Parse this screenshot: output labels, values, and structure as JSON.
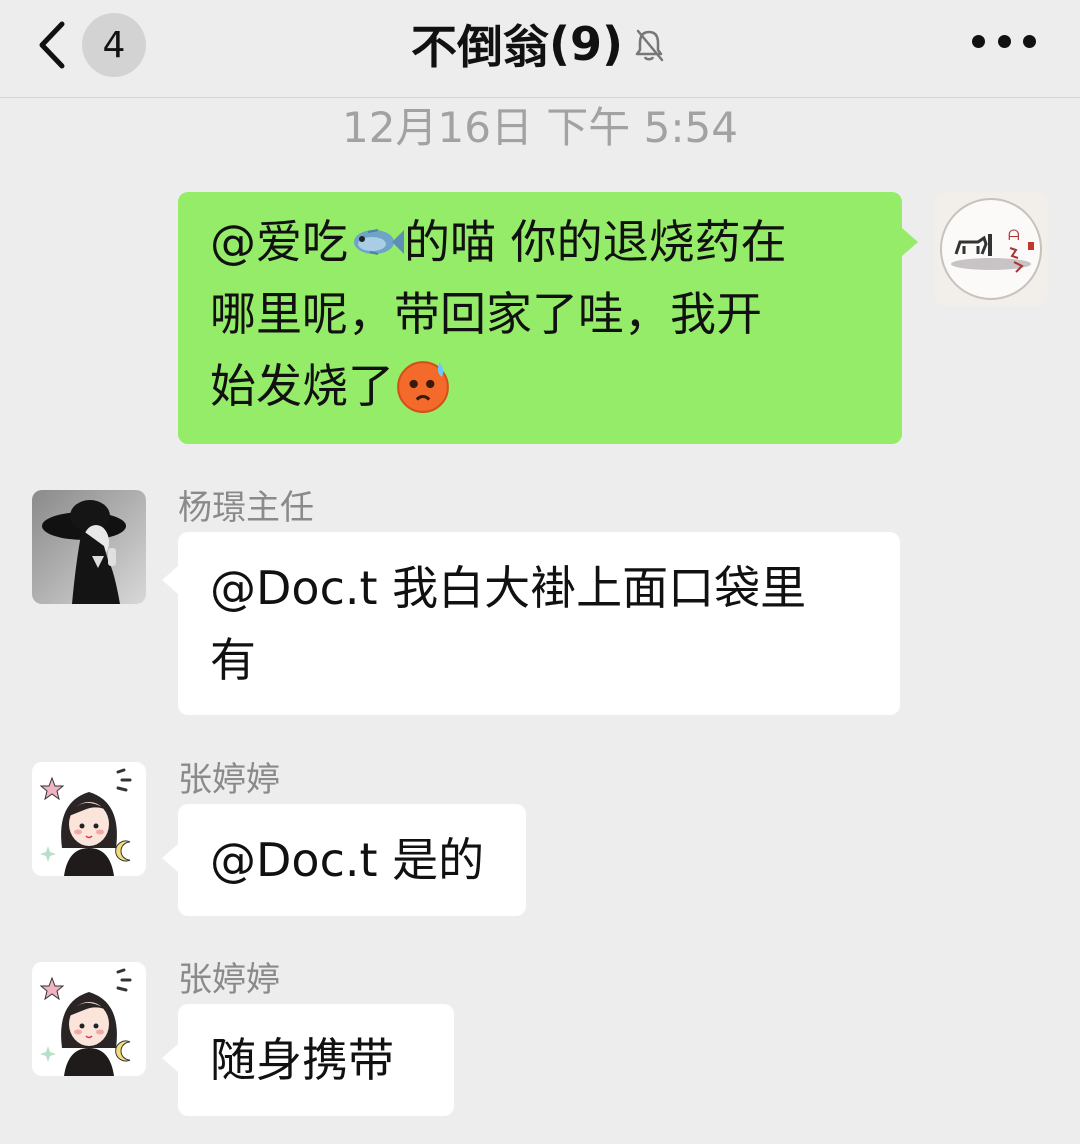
{
  "header": {
    "back_count": "4",
    "title": "不倒翁",
    "member_count": "(9)"
  },
  "timestamp": "12月16日 下午 5:54",
  "messages": [
    {
      "from": "me",
      "lines": [
        "@爱吃",
        "的喵 你的退烧药在",
        "哪里呢，带回家了哇，我开",
        "始发烧了"
      ],
      "emoji": [
        "fish-emoji",
        "hot-face-emoji"
      ]
    },
    {
      "from": "杨璟主任",
      "lines": [
        "@Doc.t 我白大褂上面口袋里",
        "有"
      ]
    },
    {
      "from": "张婷婷",
      "lines": [
        "@Doc.t 是的"
      ]
    },
    {
      "from": "张婷婷",
      "lines": [
        "随身携带"
      ]
    }
  ],
  "colors": {
    "background": "#ededed",
    "my_bubble": "#95ec69",
    "other_bubble": "#ffffff",
    "timestamp": "#a2a2a2",
    "name": "#8a8a8a"
  }
}
